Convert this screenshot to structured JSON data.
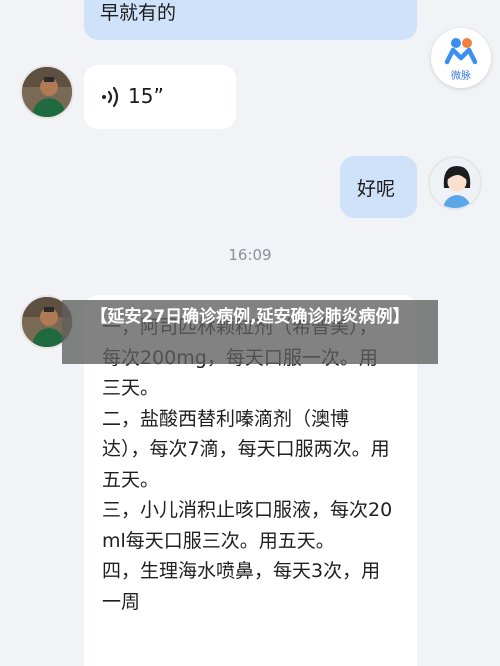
{
  "chat": {
    "msg1_text": "早就有的",
    "voice_duration": "15”",
    "reply_text": "好呢",
    "timestamp": "16:09",
    "prescription": "一，阿司匹林颗粒剂（希普美），每次200mg，每天口服一次。用三天。\n二，盐酸西替利嗪滴剂（澳博达），每次7滴，每天口服两次。用五天。\n三，小儿消积止咳口服液，每次20ml每天口服三次。用五天。\n四，生理海水喷鼻，每天3次，用一周"
  },
  "overlay": {
    "banner_text": "【延安27日确诊病例,延安确诊肺炎病例】"
  },
  "app": {
    "badge_label": "微脉"
  },
  "colors": {
    "background": "#f1f3f6",
    "incoming_bubble": "#ffffff",
    "outgoing_bubble": "#cfe2fa",
    "banner": "#5f5f5f"
  },
  "icons": [
    "voice-icon",
    "weibo-logo-icon"
  ]
}
